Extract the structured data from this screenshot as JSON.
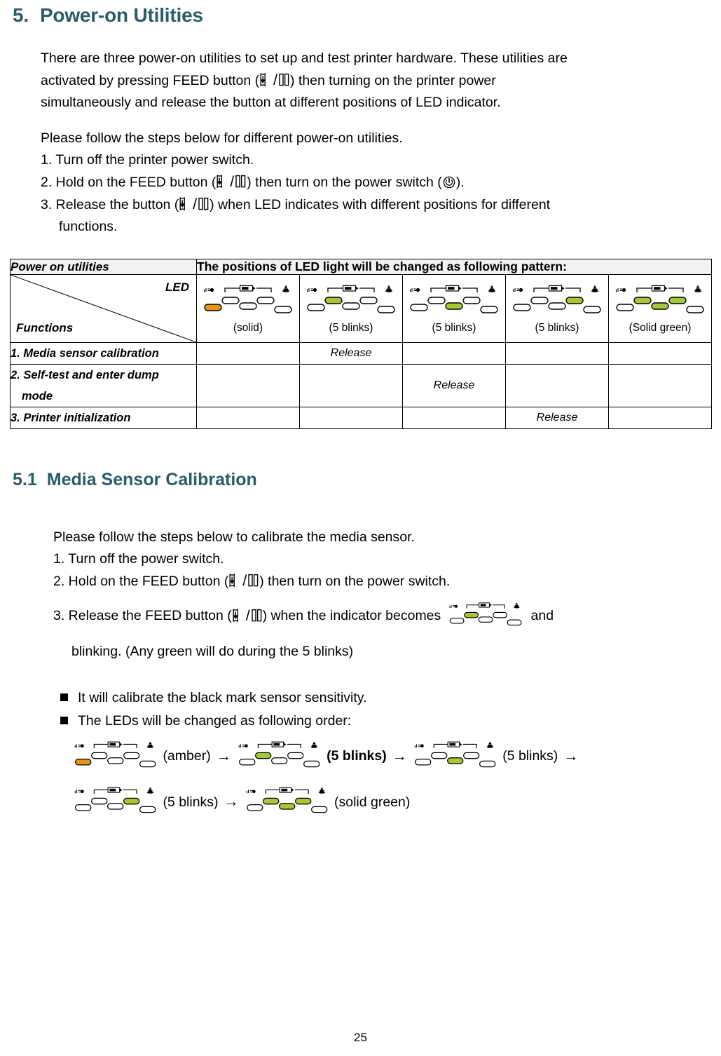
{
  "section": {
    "number": "5.",
    "title": "Power-on Utilities"
  },
  "intro": {
    "line1_a": "There are three power-on utilities to set up and test printer hardware. These utilities are",
    "line2_a": "activated by pressing FEED button (",
    "line2_b": ") then turning on the printer power",
    "line3": "simultaneously and release the button at different positions of LED indicator."
  },
  "steps_intro": "Please follow the steps below for different power-on utilities.",
  "steps": {
    "s1": "1. Turn off the printer power switch.",
    "s2_a": "2. Hold on the FEED button (",
    "s2_b": ") then turn on the power switch (",
    "s2_c": ").",
    "s3_a": "3. Release the button (",
    "s3_b": ") when LED indicates with different positions for different",
    "s3_cont": "functions."
  },
  "table": {
    "header_left": "Power on utilities",
    "header_right": "The positions of LED light will be changed as following pattern:",
    "corner_led": "LED",
    "corner_functions": "Functions",
    "led_captions": [
      "(solid)",
      "(5 blinks)",
      "(5 blinks)",
      "(5 blinks)",
      "(Solid green)"
    ],
    "led_states": [
      [
        "amber",
        "off",
        "off",
        "off",
        "off"
      ],
      [
        "off",
        "green",
        "off",
        "off",
        "off"
      ],
      [
        "off",
        "off",
        "green",
        "off",
        "off"
      ],
      [
        "off",
        "off",
        "off",
        "green",
        "off"
      ],
      [
        "off",
        "green",
        "green",
        "green",
        "off"
      ]
    ],
    "release_label": "Release",
    "rows": [
      {
        "label": "1. Media sensor calibration",
        "label_cont": "",
        "release_col": 2
      },
      {
        "label": "2. Self-test and enter dump",
        "label_cont": "mode",
        "release_col": 3
      },
      {
        "label": "3. Printer initialization",
        "label_cont": "",
        "release_col": 4
      }
    ]
  },
  "subsection": {
    "number": "5.1",
    "title": "Media Sensor Calibration"
  },
  "calib": {
    "intro": "Please follow the steps below to calibrate the media sensor.",
    "s1": "1. Turn off the power switch.",
    "s2_a": "2. Hold on the FEED button (",
    "s2_b": ") then turn on the power switch.",
    "s3_a": "3. Release the FEED button (",
    "s3_b": ") when the indicator becomes",
    "s3_c": "and",
    "s3_cont": "blinking. (Any green will do during the 5 blinks)",
    "s3_led_state": [
      "off",
      "green",
      "off",
      "off",
      "off"
    ]
  },
  "bullets": [
    "It will calibrate the black mark sensor sensitivity.",
    "The LEDs will be changed as following order:"
  ],
  "sequence": {
    "arrow": "→",
    "items": [
      {
        "state": [
          "amber",
          "off",
          "off",
          "off",
          "off"
        ],
        "label": "(amber)",
        "bold": false
      },
      {
        "state": [
          "off",
          "green",
          "off",
          "off",
          "off"
        ],
        "label": "(5 blinks)",
        "bold": true
      },
      {
        "state": [
          "off",
          "off",
          "green",
          "off",
          "off"
        ],
        "label": "(5 blinks)",
        "bold": false
      },
      {
        "state": [
          "off",
          "off",
          "off",
          "green",
          "off"
        ],
        "label": "(5 blinks)",
        "bold": false
      },
      {
        "state": [
          "off",
          "green",
          "green",
          "green",
          "off"
        ],
        "label": "(solid green)",
        "bold": false
      }
    ]
  },
  "page_number": "25",
  "colors": {
    "heading": "#2b5c6b",
    "led_green": "#a6c832",
    "led_amber": "#e8941a",
    "led_off": "#ffffff",
    "table_header_bg": "#f2f2f2",
    "rule": "#000000"
  },
  "icons": {
    "feed_button": "feed-button-icon",
    "power_switch": "power-switch-icon",
    "led_panel": "led-indicator-icon",
    "bullet": "square-bullet-icon"
  }
}
